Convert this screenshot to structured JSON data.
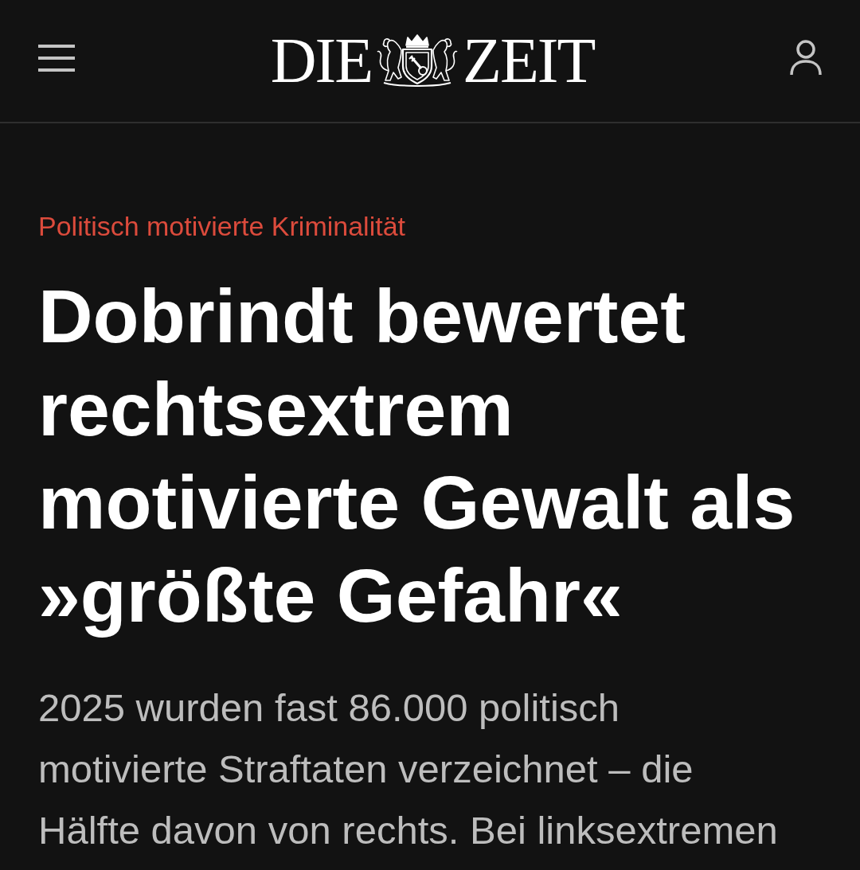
{
  "header": {
    "logo": [
      "DIE",
      "ZEIT"
    ]
  },
  "article": {
    "kicker": "Politisch motivierte Kriminalität",
    "headline": "Dobrindt bewertet rechtsextrem motivierte Gewalt als »größte Gefahr«",
    "teaser": "2025 wurden fast 86.000 politisch motivierte Straftaten verzeichnet – die Hälfte davon von rechts. Bei linksextremen"
  }
}
